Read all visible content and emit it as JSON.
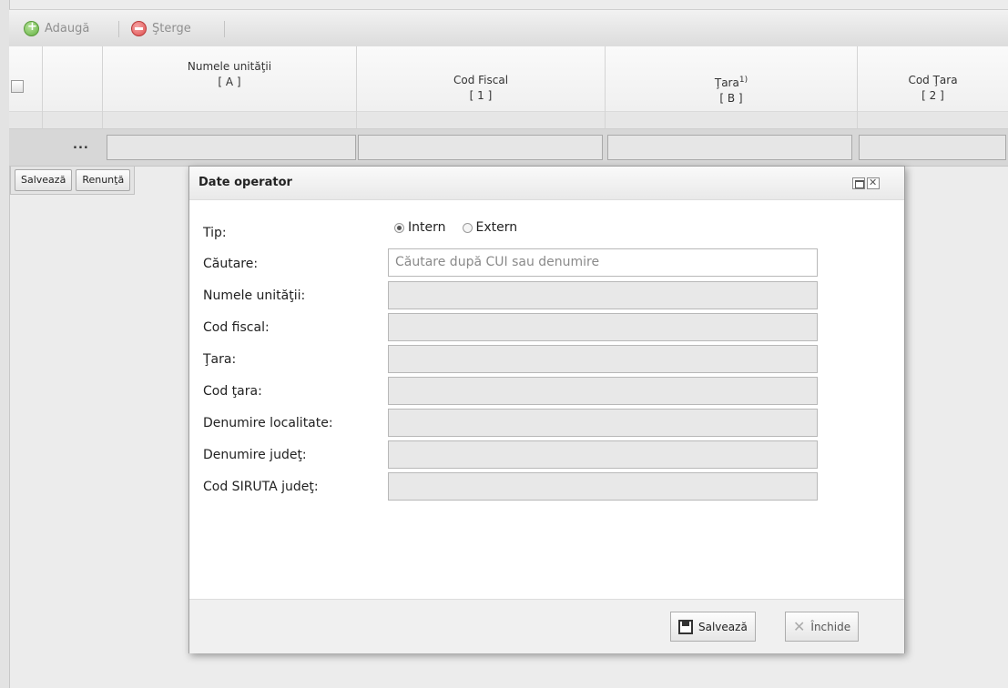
{
  "toolbar": {
    "add_label": "Adaugă",
    "delete_label": "Şterge"
  },
  "grid": {
    "columns": [
      {
        "title": "Numele unităţii",
        "code": "[ A ]"
      },
      {
        "title": "Cod Fiscal",
        "code": "[ 1 ]"
      },
      {
        "title": "Ţara",
        "sup": "1)",
        "code": "[ B ]"
      },
      {
        "title": "Cod Ţara",
        "code": "[ 2 ]"
      }
    ],
    "edit_row_marker": "...",
    "row_save_label": "Salvează",
    "row_cancel_label": "Renunţă"
  },
  "dialog": {
    "title": "Date operator",
    "tip_label": "Tip:",
    "radio_options": [
      "Intern",
      "Extern"
    ],
    "radio_selected": "Intern",
    "search_label": "Căutare:",
    "search_placeholder": "Căutare după CUI sau denumire",
    "fields": [
      "Numele unităţii:",
      "Cod fiscal:",
      "Ţara:",
      "Cod ţara:",
      "Denumire localitate:",
      "Denumire judeţ:",
      "Cod SIRUTA judeţ:"
    ],
    "save_label": "Salvează",
    "close_label": "Închide"
  }
}
